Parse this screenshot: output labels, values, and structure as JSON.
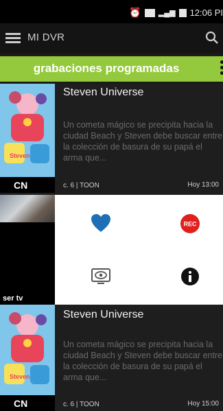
{
  "status_bar": {
    "time": "12:06 PI"
  },
  "app_bar": {
    "title": "MI DVR"
  },
  "section": {
    "title": "grabaciones programadas"
  },
  "recordings": [
    {
      "show": "Steven Universe",
      "description": "Un cometa mágico se precipita hacia la ciudad Beach y Steven debe buscar entre la colección de basura de su papá el arma que...",
      "channel_meta": "c. 6 | TOON",
      "time": "Hoy 13:00",
      "network_logo": "CN"
    },
    {
      "show": "Steven Universe",
      "description": "Un cometa mágico se precipita hacia la ciudad Beach y Steven debe buscar entre la colección de basura de su papá el arma que...",
      "channel_meta": "c. 6 | TOON",
      "time": "Hoy 15:00",
      "network_logo": "CN"
    }
  ],
  "action_row": {
    "network_logo": "ser tv",
    "rec_label": "REC"
  },
  "colors": {
    "accent_green": "#95c93d",
    "heart_blue": "#1e6fb5",
    "rec_red": "#e0201c"
  }
}
